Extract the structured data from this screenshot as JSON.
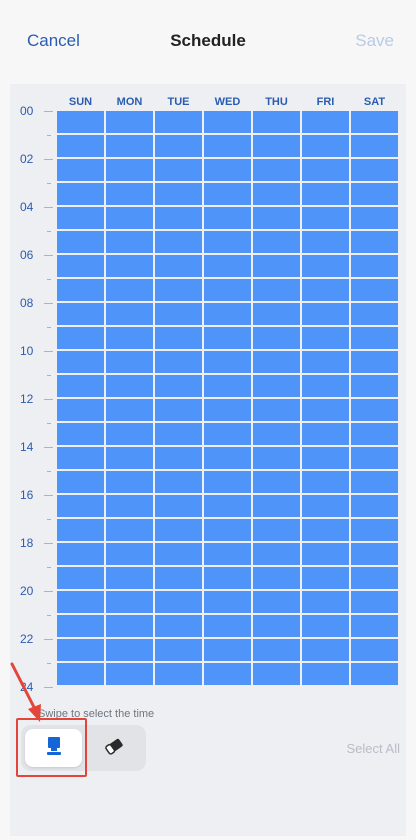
{
  "header": {
    "cancel_label": "Cancel",
    "title": "Schedule",
    "save_label": "Save"
  },
  "schedule": {
    "days": [
      "SUN",
      "MON",
      "TUE",
      "WED",
      "THU",
      "FRI",
      "SAT"
    ],
    "hour_labels": [
      "00",
      "02",
      "04",
      "06",
      "08",
      "10",
      "12",
      "14",
      "16",
      "18",
      "20",
      "22",
      "24"
    ],
    "rows": 24,
    "all_selected": true,
    "selected_color": "#4e94f9"
  },
  "hint": "Swipe to select the time",
  "tools": [
    {
      "name": "brush-icon",
      "active": true
    },
    {
      "name": "eraser-icon",
      "active": false
    }
  ],
  "select_all_label": "Select All",
  "colors": {
    "accent": "#2a5db0",
    "disabled": "#b8cbe6",
    "annotation": "#e3453a"
  }
}
